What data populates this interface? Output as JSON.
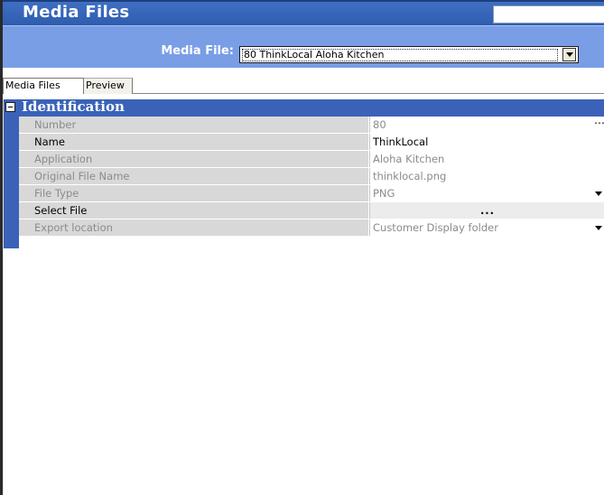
{
  "window": {
    "title": "Media Files"
  },
  "selector": {
    "label": "Media File:",
    "value": "80 ThinkLocal Aloha Kitchen"
  },
  "tabs": [
    {
      "label": "Media Files",
      "active": true
    },
    {
      "label": "Preview",
      "active": false
    }
  ],
  "category": {
    "title": "Identification",
    "toggle": "minus-icon"
  },
  "properties": [
    {
      "name": "Number",
      "value": "80"
    },
    {
      "name": "Name",
      "value": "ThinkLocal"
    },
    {
      "name": "Application",
      "value": "Aloha Kitchen"
    },
    {
      "name": "Original File Name",
      "value": "thinklocal.png"
    },
    {
      "name": "File Type",
      "value": "PNG"
    },
    {
      "name": "Select File",
      "value": "..."
    },
    {
      "name": "Export location",
      "value": "Customer Display folder"
    }
  ],
  "colors": {
    "title_bar": "#3f6fc4",
    "selector_bar": "#7a9ee6",
    "category_header": "#3a62b8",
    "disabled_text": "#8b8b8b"
  }
}
